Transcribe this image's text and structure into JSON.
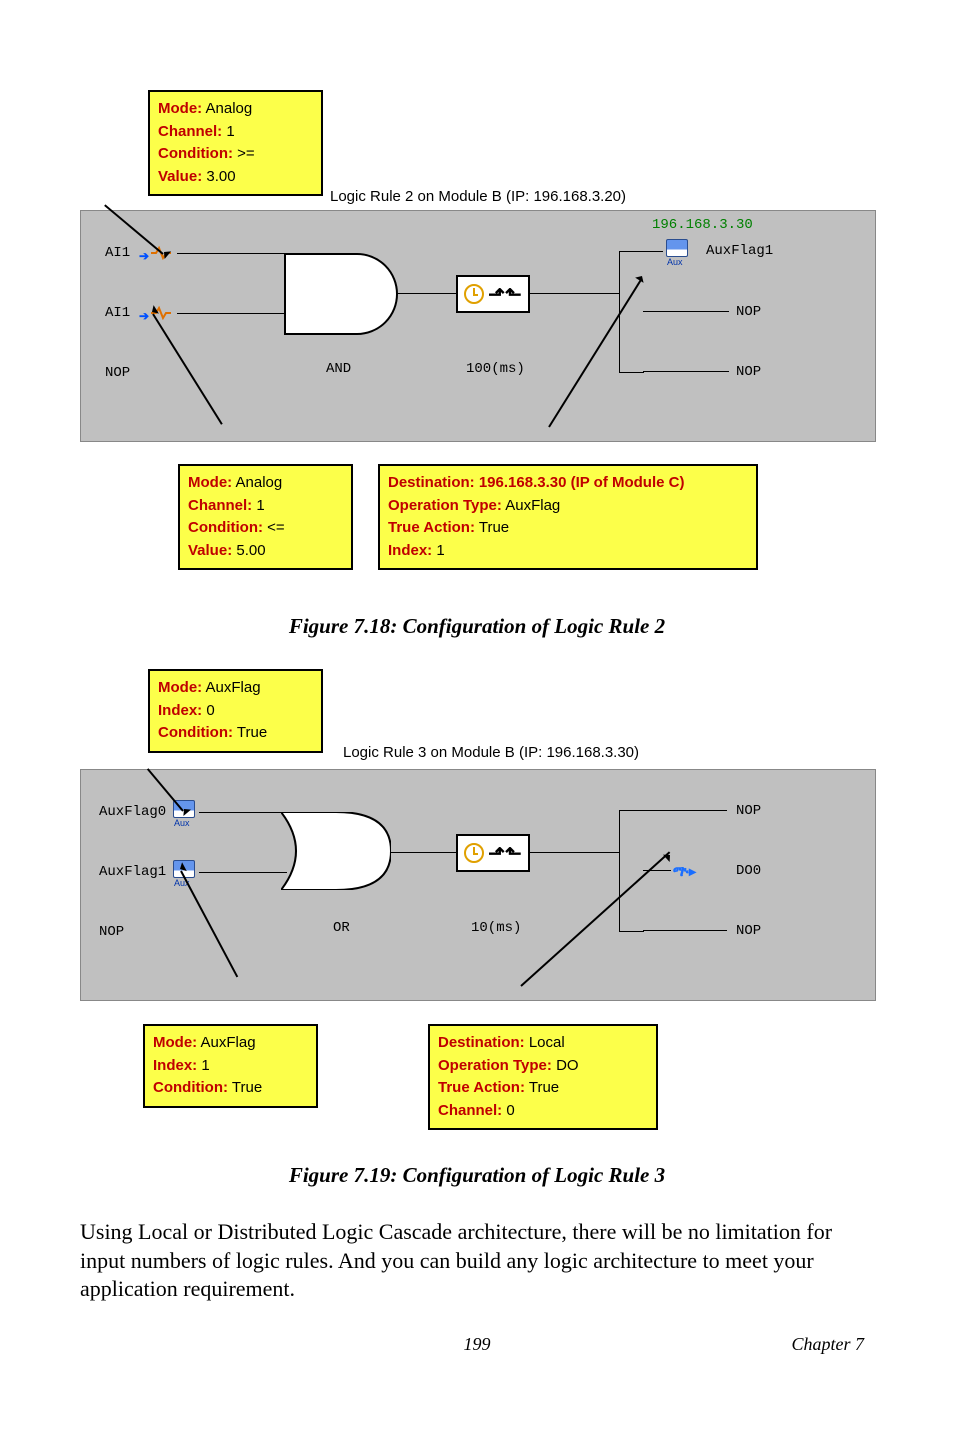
{
  "figure1": {
    "topbox": {
      "mode_label": "Mode:",
      "mode_val": " Analog",
      "channel_label": "Channel:",
      "channel_val": " 1",
      "condition_label": "Condition:",
      "condition_val": " >=",
      "value_label": "Value:",
      "value_val": " 3.00"
    },
    "title_over": "Logic Rule 2 on Module B (IP: 196.168.3.20)",
    "in1": "AI1",
    "in2": "AI1",
    "in3": "NOP",
    "gate": "AND",
    "delay": "100(ms)",
    "ip": "196.168.3.30",
    "out1": "AuxFlag1",
    "out2": "NOP",
    "out3": "NOP",
    "midbox": {
      "mode_label": "Mode:",
      "mode_val": " Analog",
      "channel_label": "Channel:",
      "channel_val": " 1",
      "condition_label": "Condition:",
      "condition_val": " <=",
      "value_label": "Value:",
      "value_val": " 5.00"
    },
    "rightbox": {
      "dest_label": "Destination: ",
      "dest_val": "196.168.3.30 (IP of Module C)",
      "op_label": "Operation Type:",
      "op_val": " AuxFlag",
      "true_label": "True Action:",
      "true_val": " True",
      "index_label": "Index:",
      "index_val": " 1"
    },
    "caption": "Figure 7.18: Configuration of Logic Rule 2"
  },
  "figure2": {
    "topbox": {
      "mode_label": "Mode:",
      "mode_val": " AuxFlag",
      "index_label": "Index:",
      "index_val": " 0",
      "condition_label": "Condition:",
      "condition_val": " True"
    },
    "title_over": "Logic Rule 3 on Module B (IP: 196.168.3.30)",
    "in1": "AuxFlag0",
    "in2": "AuxFlag1",
    "in3": "NOP",
    "gate": "OR",
    "delay": "10(ms)",
    "out1": "NOP",
    "out2": "DO0",
    "out3": "NOP",
    "midbox": {
      "mode_label": "Mode:",
      "mode_val": " AuxFlag",
      "index_label": "Index:",
      "index_val": " 1",
      "condition_label": "Condition:",
      "condition_val": " True"
    },
    "rightbox": {
      "dest_label": "Destination:",
      "dest_val": " Local",
      "op_label": "Operation Type:",
      "op_val": " DO",
      "true_label": "True Action:",
      "true_val": " True",
      "ch_label": "Channel:",
      "ch_val": " 0"
    },
    "caption": "Figure 7.19: Configuration of Logic Rule 3"
  },
  "paragraph": "Using Local or Distributed Logic Cascade architecture, there will be no limitation for input numbers of logic rules. And you can build any logic architecture to meet your application requirement.",
  "page_number": "199",
  "chapter": "Chapter 7"
}
